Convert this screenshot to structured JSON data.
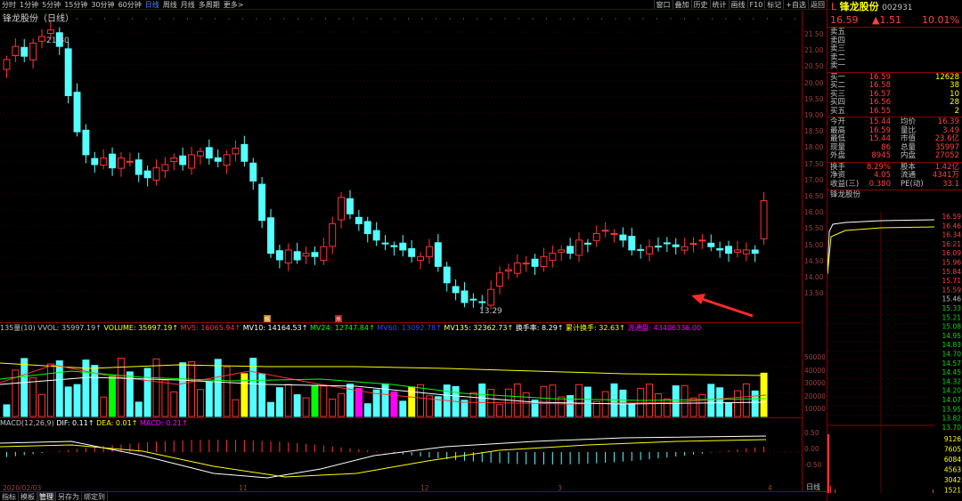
{
  "toolbar": {
    "left": [
      "分时",
      "1分钟",
      "5分钟",
      "15分钟",
      "30分钟",
      "60分钟",
      "日线",
      "周线",
      "月线",
      "多周期",
      "更多>"
    ],
    "active_index": 6,
    "right": [
      "窗口",
      "叠加",
      "历史",
      "统计",
      "画线",
      "F10",
      "标记",
      "+自选",
      "返回"
    ]
  },
  "chart": {
    "title": "锋龙股份（日线）",
    "high_label": "21.80",
    "low_label": "13.29",
    "marker_a": "糯",
    "marker_b": "杀",
    "price_ticks": [
      "21.50",
      "21.00",
      "20.50",
      "20.00",
      "19.50",
      "19.00",
      "18.50",
      "18.00",
      "17.50",
      "17.00",
      "16.50",
      "16.00",
      "15.50",
      "15.00",
      "14.50",
      "14.00",
      "13.50"
    ],
    "vol_ticks": [
      "50000",
      "40000",
      "30000",
      "20000",
      "10000"
    ],
    "macd_ticks": [
      "0.50",
      "0.00",
      "-0.50"
    ],
    "dates": [
      "2020/02/03",
      "11",
      "12",
      "3",
      "4"
    ],
    "colors": {
      "up": "#ff3333",
      "down": "#54ffff",
      "ma5": "#ffffff",
      "ma10": "#ffff00",
      "ma24": "#ff00ff",
      "ma135": "#00ff00"
    }
  },
  "volume_bar": {
    "name": "135量(10)",
    "vvol": "VVOL: 35997.19↑",
    "volume": "VOLUME: 35997.19↑",
    "mv5": "MV5: 16065.94↑",
    "mv10": "MV10: 14164.53↑",
    "mv24": "MV24: 12747.84↑",
    "mv60": "MV60: 13092.78↑",
    "mv135": "MV135: 32362.73↑",
    "turnover": "换手率: 8.29↑",
    "cum_turnover": "累计换手: 32.63↑",
    "float_cap": "流通盘: 43406336.00"
  },
  "macd_bar": {
    "name": "MACD(12,26,9)",
    "dif": "DIF: 0.11↑",
    "dea": "DEA: 0.01↑",
    "macd": "MACD: 0.21↑"
  },
  "bottom_tabs": [
    "指标",
    "模板",
    "管理",
    "另存为",
    "绑定到"
  ],
  "panel": {
    "tag": "L",
    "name": "锋龙股份",
    "code": "002931",
    "price": "16.59",
    "change": "▲1.51",
    "pct": "10.01%",
    "sells": [
      {
        "label": "卖五",
        "price": "",
        "vol": ""
      },
      {
        "label": "卖四",
        "price": "",
        "vol": ""
      },
      {
        "label": "卖三",
        "price": "",
        "vol": ""
      },
      {
        "label": "卖二",
        "price": "",
        "vol": ""
      },
      {
        "label": "卖一",
        "price": "",
        "vol": ""
      }
    ],
    "buys": [
      {
        "label": "买一",
        "price": "16.59",
        "vol": "12628"
      },
      {
        "label": "买二",
        "price": "16.58",
        "vol": "38"
      },
      {
        "label": "买三",
        "price": "16.57",
        "vol": "10"
      },
      {
        "label": "买四",
        "price": "16.56",
        "vol": "28"
      },
      {
        "label": "买五",
        "price": "16.55",
        "vol": "2"
      }
    ],
    "stats": [
      {
        "l1": "今开",
        "v1": "15.44",
        "l2": "均价",
        "v2": "16.39"
      },
      {
        "l1": "最高",
        "v1": "16.59",
        "l2": "量比",
        "v2": "3.49"
      },
      {
        "l1": "最低",
        "v1": "15.44",
        "l2": "市值",
        "v2": "23.6亿"
      },
      {
        "l1": "现量",
        "v1": "86",
        "l2": "总量",
        "v2": "35997"
      },
      {
        "l1": "外盘",
        "v1": "8945",
        "l2": "内盘",
        "v2": "27052"
      }
    ],
    "stats2": [
      {
        "l1": "换手",
        "v1": "8.29%",
        "l2": "股本",
        "v2": "1.42亿"
      },
      {
        "l1": "净资",
        "v1": "4.05",
        "l2": "流通",
        "v2": "4341万"
      },
      {
        "l1": "收益(三)",
        "v1": "0.380",
        "l2": "PE(动)",
        "v2": "33.1"
      }
    ],
    "mini_title": "锋龙股份",
    "mini_ticks": [
      "16.59",
      "16.46",
      "16.34",
      "16.21",
      "16.09",
      "15.96",
      "15.84",
      "15.71",
      "15.59",
      "15.46",
      "15.33",
      "15.21",
      "15.08",
      "14.95",
      "14.83",
      "14.70",
      "14.57",
      "14.45",
      "14.32",
      "14.20",
      "14.07",
      "13.95",
      "13.82",
      "13.70"
    ],
    "mini_vol_ticks": [
      "9126",
      "7605",
      "6084",
      "4563",
      "3042",
      "1521"
    ],
    "mini_foot": "日线"
  }
}
